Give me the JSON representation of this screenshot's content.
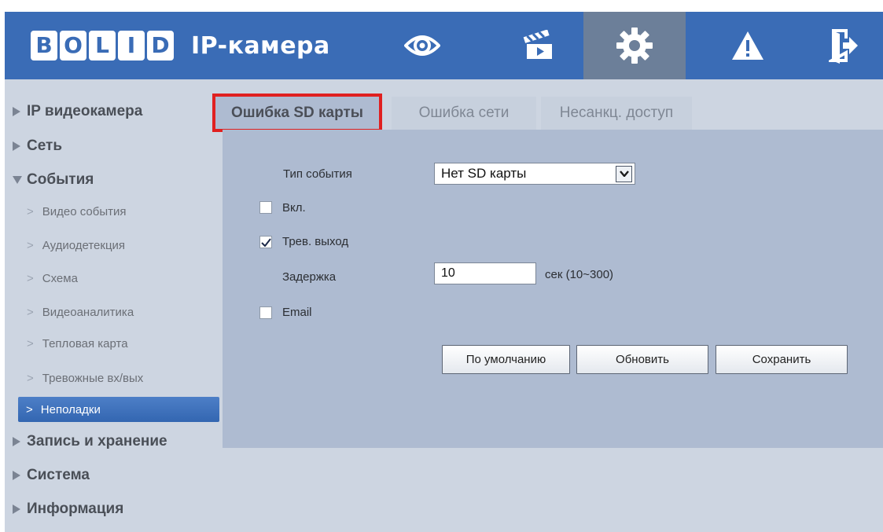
{
  "header": {
    "logo_text": "BOLID",
    "logo_letters": [
      "B",
      "O",
      "L",
      "I",
      "D"
    ],
    "title": "IP-камера",
    "nav_icons": [
      "eye-icon",
      "clapperboard-icon",
      "gear-icon",
      "warning-icon",
      "logout-icon"
    ],
    "active_nav": "gear-icon",
    "accent_color": "#3a6cb6"
  },
  "sidebar": {
    "top_items": [
      {
        "label": "IP видеокамера",
        "expanded": false
      },
      {
        "label": "Сеть",
        "expanded": false
      },
      {
        "label": "События",
        "expanded": true
      },
      {
        "label": "Запись и хранение",
        "expanded": false
      },
      {
        "label": "Система",
        "expanded": false
      },
      {
        "label": "Информация",
        "expanded": false
      }
    ],
    "sub_items": [
      {
        "label": "Видео события"
      },
      {
        "label": "Аудиодетекция"
      },
      {
        "label": "Схема"
      },
      {
        "label": "Видеоаналитика"
      },
      {
        "label": "Тепловая карта"
      },
      {
        "label": "Тревожные вх/вых"
      },
      {
        "label": "Неполадки",
        "active": true
      }
    ]
  },
  "tabs": [
    {
      "label": "Ошибка SD карты",
      "active": true
    },
    {
      "label": "Ошибка сети",
      "active": false
    },
    {
      "label": "Несанкц. доступ",
      "active": false
    }
  ],
  "form": {
    "event_type_label": "Тип события",
    "event_type_value": "Нет SD карты",
    "enable_label": "Вкл.",
    "enable_checked": false,
    "alarm_out_label": "Трев. выход",
    "alarm_out_checked": true,
    "delay_label": "Задержка",
    "delay_value": "10",
    "delay_unit": "сек (10~300)",
    "email_label": "Email",
    "email_checked": false
  },
  "buttons": {
    "default_label": "По умолчанию",
    "refresh_label": "Обновить",
    "save_label": "Сохранить"
  }
}
